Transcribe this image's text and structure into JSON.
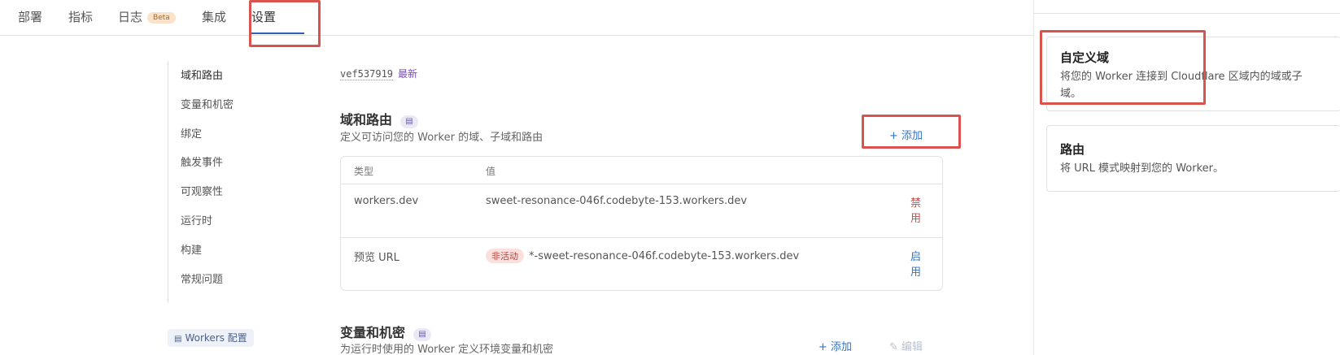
{
  "tabs": [
    {
      "label": "部署"
    },
    {
      "label": "指标"
    },
    {
      "label": "日志",
      "badge": "Beta"
    },
    {
      "label": "集成"
    },
    {
      "label": "设置",
      "active": true
    }
  ],
  "sidenav": {
    "items": [
      {
        "label": "域和路由",
        "active": true
      },
      {
        "label": "变量和机密"
      },
      {
        "label": "绑定"
      },
      {
        "label": "触发事件"
      },
      {
        "label": "可观察性"
      },
      {
        "label": "运行时"
      },
      {
        "label": "构建"
      },
      {
        "label": "常规问题"
      }
    ],
    "config_label": "Workers 配置",
    "config_icon": "book-icon"
  },
  "version": {
    "id": "vef537919",
    "tag": "最新"
  },
  "domains": {
    "title": "域和路由",
    "description": "定义可访问您的 Worker 的域、子域和路由",
    "add_label": "+ 添加",
    "table": {
      "headers": [
        "类型",
        "值"
      ],
      "rows": [
        {
          "type": "workers.dev",
          "value": "sweet-resonance-046f.codebyte-153.workers.dev",
          "status": "",
          "action": "禁用"
        },
        {
          "type": "预览 URL",
          "value": "*-sweet-resonance-046f.codebyte-153.workers.dev",
          "status": "非活动",
          "action": "启用"
        }
      ]
    }
  },
  "vars": {
    "title": "变量和机密",
    "description": "为运行时使用的 Worker 定义环境变量和机密",
    "add_label": "+ 添加",
    "edit_label": "编辑"
  },
  "panel": {
    "cards": [
      {
        "title": "自定义域",
        "description": "将您的 Worker 连接到 Cloudflare 区域内的域或子域。"
      },
      {
        "title": "路由",
        "description": "将 URL 模式映射到您的 Worker。"
      }
    ]
  },
  "colors": {
    "accent": "#2f73c8",
    "highlight": "#d9534f",
    "danger": "#c0504d"
  }
}
